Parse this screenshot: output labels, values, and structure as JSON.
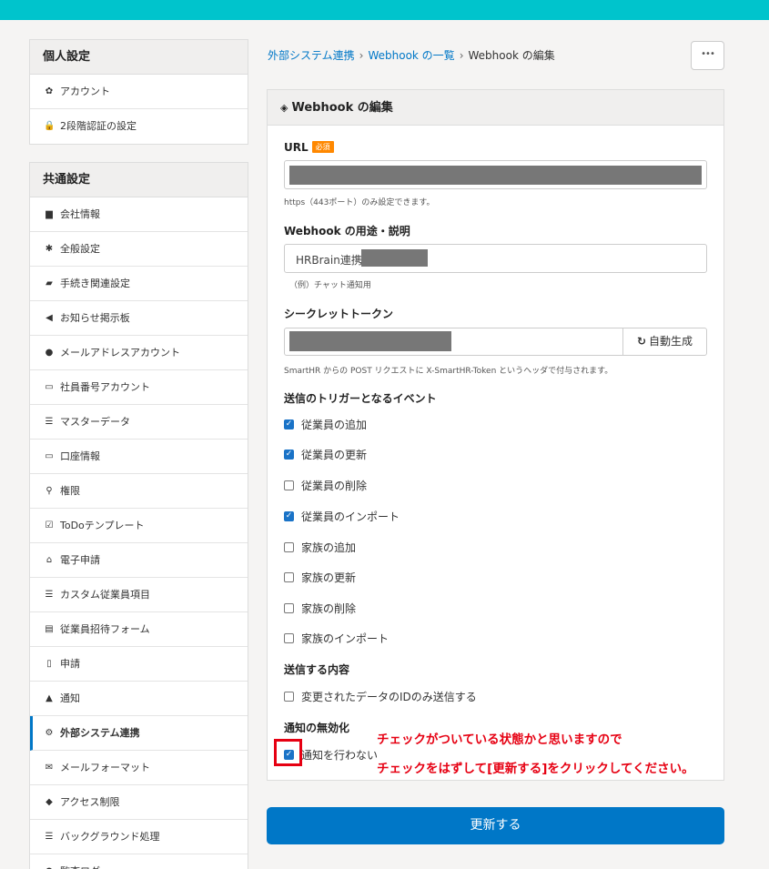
{
  "sidebar": {
    "personal": {
      "title": "個人設定",
      "items": [
        {
          "label": "アカウント",
          "icon": "✿"
        },
        {
          "label": "2段階認証の設定",
          "icon": "🔒"
        }
      ]
    },
    "common": {
      "title": "共通設定",
      "items": [
        {
          "label": "会社情報",
          "icon": "▆"
        },
        {
          "label": "全般設定",
          "icon": "✱"
        },
        {
          "label": "手続き関連設定",
          "icon": "▰"
        },
        {
          "label": "お知らせ掲示板",
          "icon": "◀"
        },
        {
          "label": "メールアドレスアカウント",
          "icon": "●"
        },
        {
          "label": "社員番号アカウント",
          "icon": "▭"
        },
        {
          "label": "マスターデータ",
          "icon": "☰"
        },
        {
          "label": "口座情報",
          "icon": "▭"
        },
        {
          "label": "権限",
          "icon": "⚲"
        },
        {
          "label": "ToDoテンプレート",
          "icon": "☑"
        },
        {
          "label": "電子申請",
          "icon": "⌂"
        },
        {
          "label": "カスタム従業員項目",
          "icon": "☰"
        },
        {
          "label": "従業員招待フォーム",
          "icon": "▤"
        },
        {
          "label": "申請",
          "icon": "▯"
        },
        {
          "label": "通知",
          "icon": "▲"
        },
        {
          "label": "外部システム連携",
          "icon": "⚙"
        },
        {
          "label": "メールフォーマット",
          "icon": "✉"
        },
        {
          "label": "アクセス制限",
          "icon": "◆"
        },
        {
          "label": "バックグラウンド処理",
          "icon": "☰"
        },
        {
          "label": "監査ログ",
          "icon": "●"
        }
      ]
    }
  },
  "breadcrumb": {
    "link1": "外部システム連携",
    "link2": "Webhook の一覧",
    "current": "Webhook の編集",
    "sep": "›"
  },
  "more_button": "•••",
  "panel": {
    "title": "Webhook の編集",
    "icon": "◈",
    "url_label": "URL",
    "required_badge": "必須",
    "url_hint": "https（443ポート）のみ設定できます。",
    "purpose_label": "Webhook の用途・説明",
    "purpose_value": "HRBrain連携",
    "purpose_hint": "（例）チャット通知用",
    "secret_label": "シークレットトークン",
    "generate_button": "自動生成",
    "generate_icon": "↻",
    "secret_hint": "SmartHR からの POST リクエストに X-SmartHR-Token というヘッダで付与されます。",
    "trigger_label": "送信のトリガーとなるイベント",
    "triggers": [
      {
        "label": "従業員の追加",
        "checked": true
      },
      {
        "label": "従業員の更新",
        "checked": true
      },
      {
        "label": "従業員の削除",
        "checked": false
      },
      {
        "label": "従業員のインポート",
        "checked": true
      },
      {
        "label": "家族の追加",
        "checked": false
      },
      {
        "label": "家族の更新",
        "checked": false
      },
      {
        "label": "家族の削除",
        "checked": false
      },
      {
        "label": "家族のインポート",
        "checked": false
      }
    ],
    "content_label": "送信する内容",
    "content_option": "変更されたデータのIDのみ送信する",
    "disable_label": "通知の無効化",
    "disable_option": "通知を行わない",
    "submit": "更新する"
  },
  "annotation": {
    "line1": "チェックがついている状態かと思いますので",
    "line2": "チェックをはずして[更新する]をクリックしてください。"
  },
  "colors": {
    "topbar": "#00c4cc",
    "link": "#0077c7",
    "primary": "#0077c7",
    "required": "#ff8800",
    "annotation": "#e60012"
  }
}
